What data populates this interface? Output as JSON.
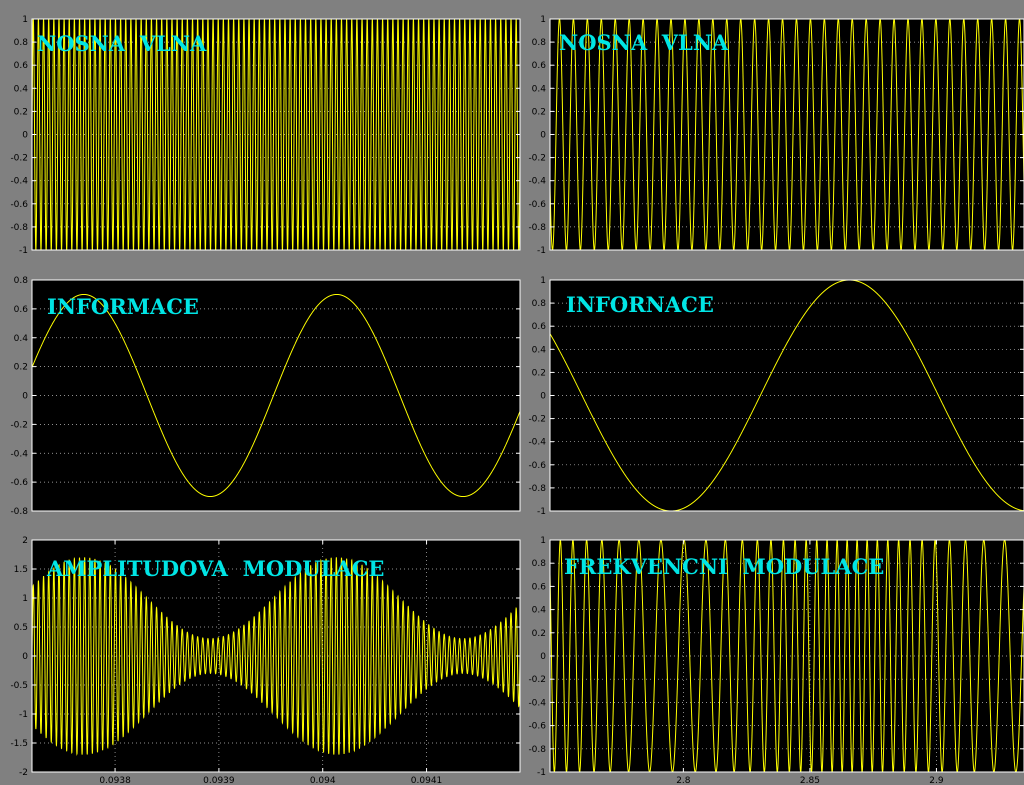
{
  "colors": {
    "figure_bg": "#808080",
    "axes_bg": "#000000",
    "axes_frame": "#ffffff",
    "grid": "#ffffff",
    "trace": "#ffff00",
    "label": "#00e5e5"
  },
  "chart_data": [
    {
      "type": "line",
      "title": "NOSNA  VLNA",
      "grid": true,
      "xlim": [
        0.09372,
        0.09419
      ],
      "xticks": [],
      "ylim": [
        -1,
        1
      ],
      "yticks": [
        -1,
        -0.8,
        -0.6,
        -0.4,
        -0.2,
        0,
        0.2,
        0.4,
        0.6,
        0.8,
        1
      ],
      "ytick_labels": [
        "-1",
        "-0.8",
        "-0.6",
        "-0.4",
        "-0.2",
        "0",
        "0.2",
        "0.4",
        "0.6",
        "0.8",
        "1"
      ],
      "series": [
        {
          "kind": "sine",
          "amplitude": 1,
          "cycles_in_view": 95,
          "phase": 0
        }
      ]
    },
    {
      "type": "line",
      "title": "NOSNA  VLNA",
      "grid": true,
      "xlim": [
        2.7473,
        2.9346
      ],
      "xticks": [],
      "ylim": [
        -1,
        1
      ],
      "yticks": [
        -1,
        -0.8,
        -0.6,
        -0.4,
        -0.2,
        0,
        0.2,
        0.4,
        0.6,
        0.8,
        1
      ],
      "ytick_labels": [
        "-1",
        "-0.8",
        "-0.6",
        "-0.4",
        "-0.2",
        "0",
        "0.2",
        "0.4",
        "0.6",
        "0.8",
        "1"
      ],
      "series": [
        {
          "kind": "sine",
          "amplitude": 1,
          "cycles_in_view": 34,
          "phase": 1.57
        }
      ]
    },
    {
      "type": "line",
      "title": "INFORMACE",
      "grid": true,
      "xlim": [
        0.09372,
        0.09419
      ],
      "xticks": [],
      "ylim": [
        -0.8,
        0.8
      ],
      "yticks": [
        -0.8,
        -0.6,
        -0.4,
        -0.2,
        0,
        0.2,
        0.4,
        0.6,
        0.8
      ],
      "ytick_labels": [
        "-0.8",
        "-0.6",
        "-0.4",
        "-0.2",
        "0",
        "0.2",
        "0.4",
        "0.6",
        "0.8"
      ],
      "series": [
        {
          "kind": "sine",
          "amplitude": 0.7,
          "cycles_in_view": 1.93,
          "phase": 0.045
        }
      ]
    },
    {
      "type": "line",
      "title": "INFORNACE",
      "grid": true,
      "xlim": [
        2.7473,
        2.9346
      ],
      "xticks": [],
      "ylim": [
        -1,
        1
      ],
      "yticks": [
        -1,
        -0.8,
        -0.6,
        -0.4,
        -0.2,
        0,
        0.2,
        0.4,
        0.6,
        0.8,
        1
      ],
      "ytick_labels": [
        "-1",
        "-0.8",
        "-0.6",
        "-0.4",
        "-0.2",
        "0",
        "0.2",
        "0.4",
        "0.6",
        "0.8",
        "1"
      ],
      "series": [
        {
          "kind": "sine",
          "amplitude": 1,
          "cycles_in_view": 1.33,
          "phase": 0.41
        }
      ]
    },
    {
      "type": "line",
      "title": "AMPLITUDOVA  MODULACE",
      "grid": true,
      "xlim": [
        0.09372,
        0.09419
      ],
      "xticks": [
        0.0938,
        0.0939,
        0.094,
        0.0941
      ],
      "xtick_labels": [
        "0.0938",
        "0.0939",
        "0.094",
        "0.0941"
      ],
      "ylim": [
        -2,
        2
      ],
      "yticks": [
        -2,
        -1.5,
        -1,
        -0.5,
        0,
        0.5,
        1,
        1.5,
        2
      ],
      "ytick_labels": [
        "-2",
        "-1.5",
        "-1",
        "-0.5",
        "0",
        "0.5",
        "1",
        "1.5",
        "2"
      ],
      "series": [
        {
          "kind": "am",
          "carrier_amplitude": 1,
          "carrier_cycles_in_view": 95,
          "modulation_index": 0.7,
          "modulation_cycles_in_view": 1.93,
          "modulation_phase": 0.045
        }
      ]
    },
    {
      "type": "line",
      "title": "FREKVENCNI  MODULACE",
      "grid": true,
      "xlim": [
        2.7473,
        2.9346
      ],
      "xticks": [
        2.8,
        2.85,
        2.9
      ],
      "xtick_labels": [
        "2.8",
        "2.85",
        "2.9"
      ],
      "ylim": [
        -1,
        1
      ],
      "yticks": [
        -1,
        -0.8,
        -0.6,
        -0.4,
        -0.2,
        0,
        0.2,
        0.4,
        0.6,
        0.8,
        1
      ],
      "ytick_labels": [
        "-1",
        "-0.8",
        "-0.6",
        "-0.4",
        "-0.2",
        "0",
        "0.2",
        "0.4",
        "0.6",
        "0.8",
        "1"
      ],
      "series": [
        {
          "kind": "fm",
          "amplitude": 1,
          "carrier_cycles_in_view": 34,
          "deviation_fraction": 0.4,
          "modulation_cycles_in_view": 1.33,
          "modulation_phase": 0.41
        }
      ]
    }
  ]
}
